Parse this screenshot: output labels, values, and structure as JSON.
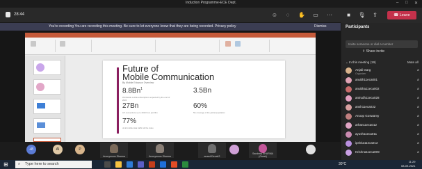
{
  "window": {
    "title": "Induction Programme-ECE Dept."
  },
  "toolbar": {
    "timer": "28:44"
  },
  "actions": {
    "leave_label": "Leave"
  },
  "banner": {
    "text": "You're recording  You are recording this meeting. Be sure to let everyone know that they are being recorded. Privacy policy",
    "dismiss": "Dismiss"
  },
  "slide": {
    "title_line1": "Future of",
    "title_line2": "Mobile Communication",
    "source": "By Mobile Ericsson Overview",
    "stats": [
      {
        "value": "8.8Bn",
        "superscript": "1",
        "desc": "Worldwide mobile subscriptions expected by the end of 2024"
      },
      {
        "value": "3.5Bn",
        "superscript": "",
        "desc": ""
      },
      {
        "value": "27Bn",
        "superscript": "",
        "desc": "IoT connections up to 2023 from just 9bn"
      },
      {
        "value": "60%",
        "superscript": "",
        "desc": "5G coverage of the global population"
      },
      {
        "value": "77%",
        "superscript": "",
        "desc": "of all mobile data traffic will be video"
      }
    ]
  },
  "presenter": {
    "label": "Sandeep Sharma (Guest)"
  },
  "strip": {
    "avatars": [
      "+8",
      "AI",
      "P"
    ],
    "tiles": [
      "Anonymous Sharma",
      "Anonymous Sharma",
      "anand11eca42",
      "",
      "Sandeep SHARMA (Guest)",
      ""
    ]
  },
  "panel": {
    "title": "Participants",
    "invite_placeholder": "Invite someone or dial a number",
    "share_invite": "Share invite",
    "in_meeting": "In this meeting (19)",
    "mute_all": "Mute all",
    "participants": [
      {
        "name": "Anjali Garg",
        "sub": "Organizer",
        "color": "#d9b38c"
      },
      {
        "name": "anubh11eca001",
        "sub": "",
        "color": "#e1a3b5"
      },
      {
        "name": "anubha11eca002",
        "sub": "",
        "color": "#c86b6b"
      },
      {
        "name": "anirudh11eca028",
        "sub": "",
        "color": "#e3a0c0"
      },
      {
        "name": "ansh11eca032",
        "sub": "",
        "color": "#d8a0a0"
      },
      {
        "name": "Anoop Goswamy",
        "sub": "",
        "color": "#c07f7f"
      },
      {
        "name": "arhan11eca012",
        "sub": "",
        "color": "#e0a4c4"
      },
      {
        "name": "ayush11eca011",
        "sub": "",
        "color": "#c98ab0"
      },
      {
        "name": "ipshita11eca012",
        "sub": "",
        "color": "#b98fe0"
      },
      {
        "name": "Krishna11eca009",
        "sub": "",
        "color": "#caa0e4"
      }
    ]
  },
  "taskbar": {
    "search_placeholder": "Type here to search",
    "weather": "30°C",
    "time": "11:29",
    "date": "08-09-2021"
  }
}
